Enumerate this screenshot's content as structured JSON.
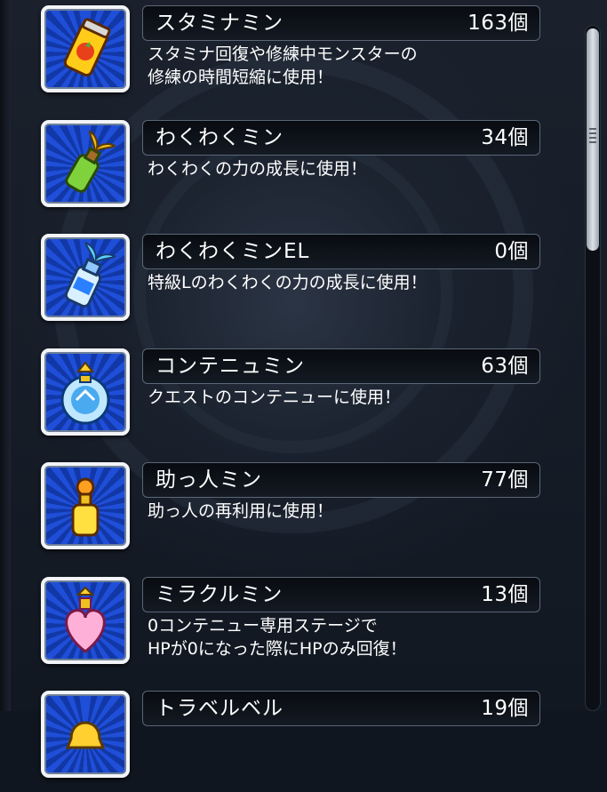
{
  "items": [
    {
      "name": "スタミナミン",
      "count": "163個",
      "desc": [
        "スタミナ回復や修練中モンスターの",
        "修練の時間短縮に使用！"
      ],
      "icon": "stamina-can-icon"
    },
    {
      "name": "わくわくミン",
      "count": "34個",
      "desc": [
        "わくわくの力の成長に使用！"
      ],
      "icon": "sprout-bottle-icon"
    },
    {
      "name": "わくわくミンEL",
      "count": "0個",
      "desc": [
        "特級Lのわくわくの力の成長に使用！"
      ],
      "icon": "el-bottle-icon"
    },
    {
      "name": "コンテニュミン",
      "count": "63個",
      "desc": [
        "クエストのコンテニューに使用！"
      ],
      "icon": "continue-orb-icon"
    },
    {
      "name": "助っ人ミン",
      "count": "77個",
      "desc": [
        "助っ人の再利用に使用！"
      ],
      "icon": "helper-bottle-icon"
    },
    {
      "name": "ミラクルミン",
      "count": "13個",
      "desc": [
        "0コンテニュー専用ステージで",
        "HPが0になった際にHPのみ回復！"
      ],
      "icon": "heart-bottle-icon"
    },
    {
      "name": "トラベルベル",
      "count": "19個",
      "desc": [],
      "icon": "bell-icon"
    }
  ],
  "colors": {
    "icon_bg": "#1f4fd8",
    "text": "#ffffff",
    "bar_bg": "#0b0f16"
  }
}
